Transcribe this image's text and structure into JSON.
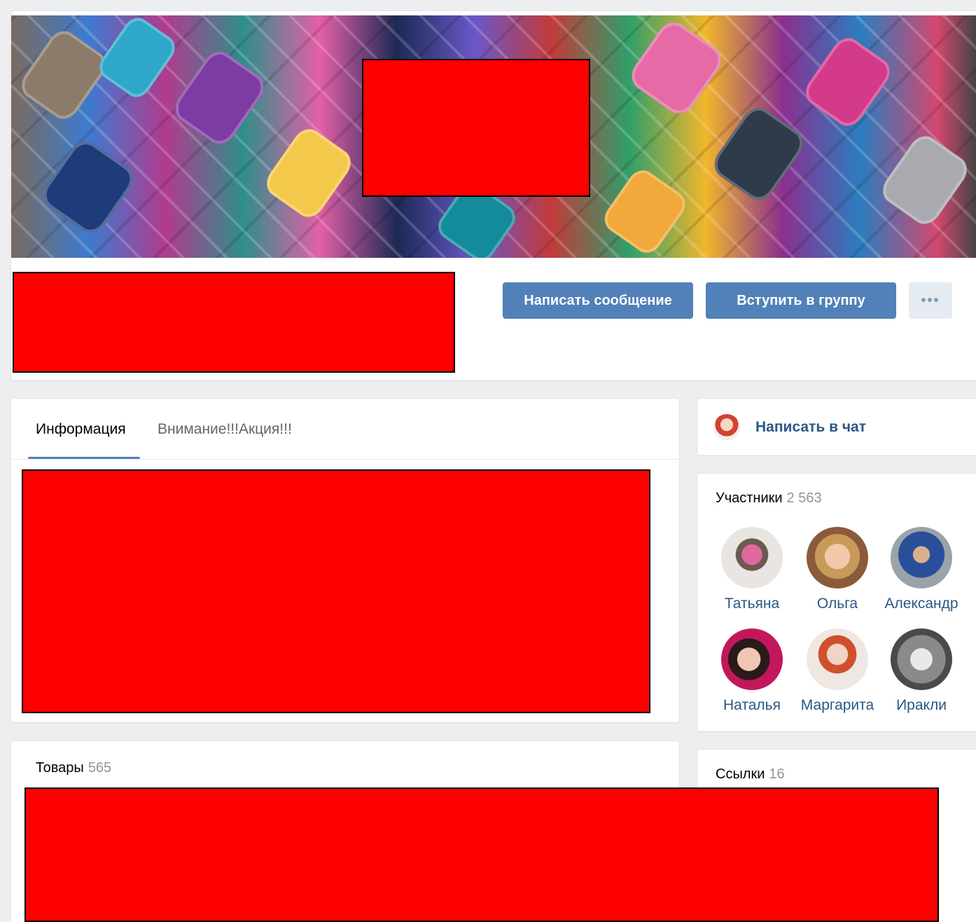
{
  "header": {
    "buttons": {
      "message": "Написать сообщение",
      "join": "Вступить в группу",
      "more": "•••"
    }
  },
  "info": {
    "tabs": [
      "Информация",
      "Внимание!!!Акция!!!"
    ]
  },
  "goods": {
    "title": "Товары",
    "count": "565"
  },
  "chat": {
    "label": "Написать в чат"
  },
  "members": {
    "title": "Участники",
    "count": "2 563",
    "people": [
      "Татьяна",
      "Ольга",
      "Александр",
      "Наталья",
      "Маргарита",
      "Иракли"
    ]
  },
  "links": {
    "title": "Ссылки",
    "count": "16"
  },
  "colors": {
    "accent": "#5181b8",
    "link": "#2a5885",
    "redaction": "#ff0000"
  }
}
